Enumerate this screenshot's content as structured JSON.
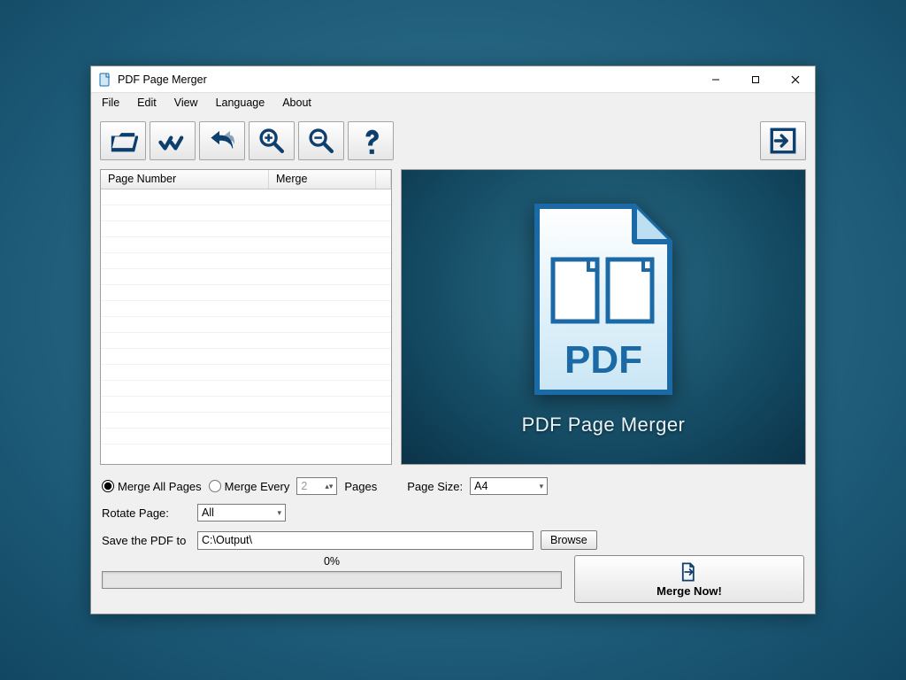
{
  "window": {
    "title": "PDF Page Merger"
  },
  "menu": {
    "file": "File",
    "edit": "Edit",
    "view": "View",
    "language": "Language",
    "about": "About"
  },
  "list": {
    "col_page_number": "Page Number",
    "col_merge": "Merge"
  },
  "preview": {
    "title": "PDF Page Merger",
    "pdf_label": "PDF"
  },
  "options": {
    "merge_all": "Merge All Pages",
    "merge_every": "Merge Every",
    "merge_every_value": "2",
    "pages_word": "Pages",
    "page_size_label": "Page Size:",
    "page_size_value": "A4",
    "rotate_label": "Rotate Page:",
    "rotate_value": "All",
    "save_label": "Save the PDF to",
    "save_path": "C:\\Output\\",
    "browse": "Browse"
  },
  "progress": {
    "label": "0%"
  },
  "merge_button": "Merge Now!"
}
